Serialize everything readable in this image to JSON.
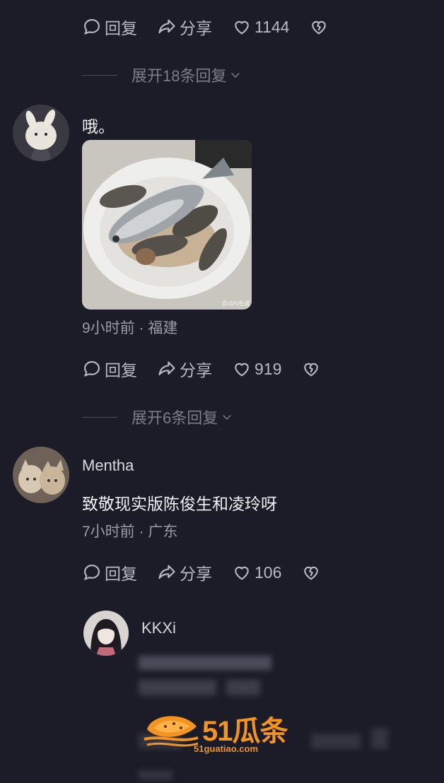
{
  "thread_top": {
    "actions": {
      "reply": "回复",
      "share": "分享",
      "likes": "1144"
    },
    "expand_label": "展开18条回复"
  },
  "comment1": {
    "text": "哦。",
    "image_watermark": "自动AI生成",
    "meta": "9小时前 · 福建",
    "actions": {
      "reply": "回复",
      "share": "分享",
      "likes": "919"
    },
    "expand_label": "展开6条回复"
  },
  "comment2": {
    "username": "Mentha",
    "text": "致敬现实版陈俊生和凌玲呀",
    "meta": "7小时前 · 广东",
    "actions": {
      "reply": "回复",
      "share": "分享",
      "likes": "106"
    }
  },
  "reply1": {
    "username": "KKXi"
  },
  "watermark": {
    "brand": "51瓜条",
    "url": "51guatiao.com"
  },
  "colors": {
    "background": "#1b1c27",
    "text_primary": "#f0f0f4",
    "text_secondary": "#9a9ba5",
    "brand_orange": "#f29322"
  }
}
